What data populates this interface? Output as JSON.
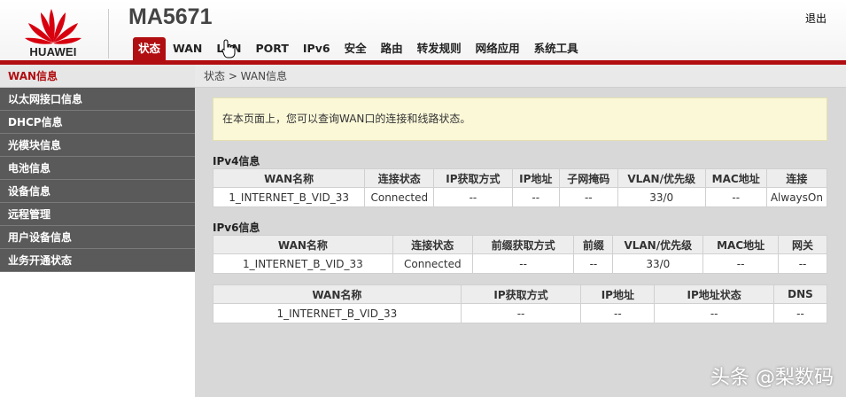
{
  "header": {
    "brand": "HUAWEI",
    "model": "MA5671",
    "logout": "退出",
    "nav": [
      "状态",
      "WAN",
      "LAN",
      "PORT",
      "IPv6",
      "安全",
      "路由",
      "转发规则",
      "网络应用",
      "系统工具"
    ],
    "active_nav": "状态"
  },
  "sidebar": {
    "items": [
      "WAN信息",
      "以太网接口信息",
      "DHCP信息",
      "光模块信息",
      "电池信息",
      "设备信息",
      "远程管理",
      "用户设备信息",
      "业务开通状态"
    ],
    "active": "WAN信息"
  },
  "main": {
    "breadcrumb": "状态 > WAN信息",
    "info": "在本页面上，您可以查询WAN口的连接和线路状态。",
    "ipv4": {
      "title": "IPv4信息",
      "headers": [
        "WAN名称",
        "连接状态",
        "IP获取方式",
        "IP地址",
        "子网掩码",
        "VLAN/优先级",
        "MAC地址",
        "连接"
      ],
      "rows": [
        [
          "1_INTERNET_B_VID_33",
          "Connected",
          "--",
          "--",
          "--",
          "33/0",
          "--",
          "AlwaysOn"
        ]
      ]
    },
    "ipv6": {
      "title": "IPv6信息",
      "headers": [
        "WAN名称",
        "连接状态",
        "前缀获取方式",
        "前缀",
        "VLAN/优先级",
        "MAC地址",
        "网关"
      ],
      "rows": [
        [
          "1_INTERNET_B_VID_33",
          "Connected",
          "--",
          "--",
          "33/0",
          "--",
          "--"
        ]
      ]
    },
    "ipv6b": {
      "headers": [
        "WAN名称",
        "IP获取方式",
        "IP地址",
        "IP地址状态",
        "DNS"
      ],
      "rows": [
        [
          "1_INTERNET_B_VID_33",
          "--",
          "--",
          "--",
          "--"
        ]
      ]
    }
  },
  "watermark": "头条 @梨数码",
  "colors": {
    "brand_red": "#b10e11",
    "sidebar_bg": "#5a5a5a",
    "info_bg": "#fbf8d8"
  }
}
